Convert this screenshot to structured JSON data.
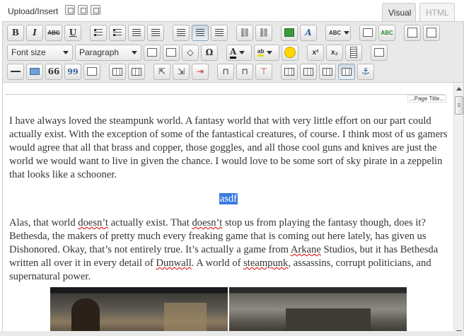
{
  "header": {
    "upload_label": "Upload/Insert",
    "upload_icons": [
      "add-image-icon",
      "add-video-icon",
      "add-media-icon"
    ],
    "tabs": [
      {
        "label": "Visual",
        "active": true
      },
      {
        "label": "HTML",
        "active": false
      }
    ]
  },
  "toolbar": {
    "row1": [
      "bold",
      "italic",
      "strikethrough",
      "underline",
      "bulleted-list",
      "numbered-list",
      "outdent",
      "indent",
      "align-left",
      "align-center",
      "align-right",
      "link",
      "unlink",
      "insert-image",
      "style",
      "spellcheck",
      "fullscreen",
      "spellcheck-as-you-type",
      "page-break",
      "insert-more"
    ],
    "row2": {
      "font_size": "Font size",
      "paragraph": "Paragraph",
      "buttons": [
        "paste-text",
        "paste-word",
        "clear-formatting",
        "special-character",
        "text-color",
        "highlight-color",
        "emoticon",
        "superscript",
        "subscript",
        "insert-media",
        "help"
      ]
    },
    "row3": [
      "horizontal-rule",
      "insert-table-row",
      "blockquote",
      "cite",
      "edit",
      "table",
      "table-cell",
      "table-row-before",
      "table-row-after",
      "delete-row",
      "col-before",
      "col-after",
      "delete-col",
      "merge-cells",
      "split-cells",
      "delete-table",
      "table-props",
      "anchor"
    ],
    "bold": "B",
    "italic": "I",
    "strike": "ABC",
    "underline": "U",
    "omega": "Ω",
    "text_a": "A",
    "highlight": "ab",
    "superscript": "x²",
    "subscript": "x₂",
    "quote": "66",
    "cite_quote": "99",
    "spell": "ABC"
  },
  "content": {
    "page_title_marker": "...Page Title...",
    "para1": "I have always loved the steampunk world.  A fantasy world that with very little effort on our part could actually exist.  With the exception of some of the fantastical creatures, of course.  I think most of us gamers would agree that all that brass and copper, those goggles, and all those cool guns and knives are just the world we would want to live in given the chance.  I would love to be some sort of sky pirate in a zeppelin that looks like a schooner.",
    "selected_word": "asdf",
    "para2_a": "Alas, that world ",
    "para2_squig1": "doesn’t",
    "para2_b": " actually exist.  That ",
    "para2_squig2": "doesn’t",
    "para2_c": " stop us from playing the fantasy though, does it?  Bethesda, the makers of pretty much every freaking game that is coming out here lately, has given us Dishonored.  Okay, that’s not entirely true.  It’s actually a game from ",
    "para2_squig3": "Arkane",
    "para2_d": " Studios, but it has Bethesda written all over it in every detail of ",
    "para2_squig4": "Dunwall",
    "para2_e": ".  A world of ",
    "para2_squig5": "steampunk",
    "para2_f": ", assassins, corrupt politicians, and supernatural power."
  },
  "colors": {
    "selection": "#3b7be0",
    "toolbar_bg": "#e9e9e9",
    "tab_active": "#e9e9e9"
  }
}
